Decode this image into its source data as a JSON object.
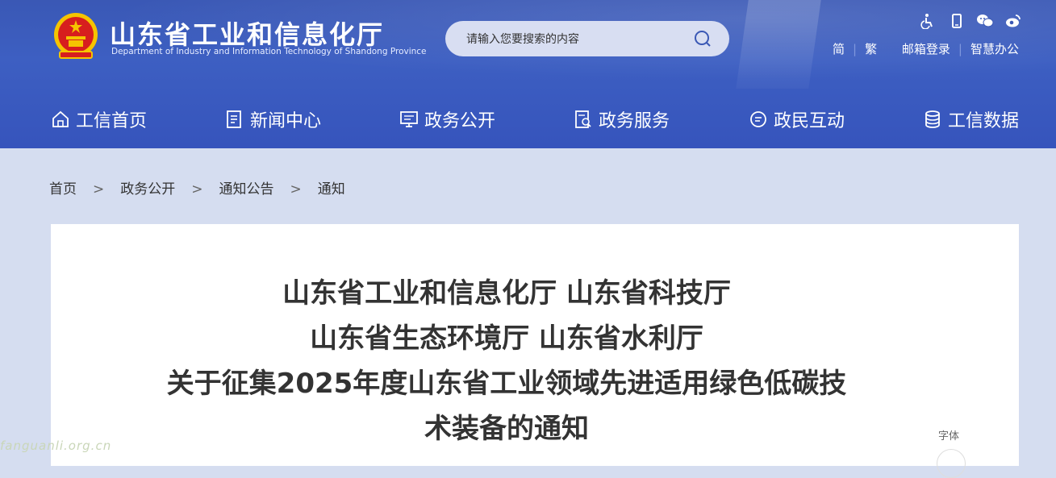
{
  "header": {
    "title": "山东省工业和信息化厅",
    "subtitle": "Department of Industry and Information Technology of Shandong Province",
    "top_icons": [
      "accessibility-icon",
      "mobile-icon",
      "wechat-icon",
      "weibo-icon"
    ],
    "links": {
      "simplified": "简",
      "traditional": "繁",
      "mail_login": "邮箱登录",
      "smart_office": "智慧办公"
    }
  },
  "search": {
    "placeholder": "请输入您要搜索的内容"
  },
  "nav": [
    {
      "label": "工信首页",
      "icon": "home-icon"
    },
    {
      "label": "新闻中心",
      "icon": "news-icon"
    },
    {
      "label": "政务公开",
      "icon": "monitor-icon"
    },
    {
      "label": "政务服务",
      "icon": "service-doc-icon"
    },
    {
      "label": "政民互动",
      "icon": "chat-icon"
    },
    {
      "label": "工信数据",
      "icon": "database-icon"
    }
  ],
  "breadcrumb": {
    "items": [
      "首页",
      "政务公开",
      "通知公告",
      "通知"
    ],
    "separator": ">"
  },
  "article": {
    "title_lines": [
      "山东省工业和信息化厅 山东省科技厅",
      "山东省生态环境厅 山东省水利厅",
      "关于征集2025年度山东省工业领域先进适用绿色低碳技",
      "术装备的通知"
    ],
    "font_label": "字体"
  },
  "watermark": "fanguanli.org.cn",
  "colors": {
    "header_blue": "#3a58b5",
    "page_bg": "#d5ddf0",
    "emblem_red": "#d71e1e",
    "emblem_gold": "#f5c400"
  }
}
